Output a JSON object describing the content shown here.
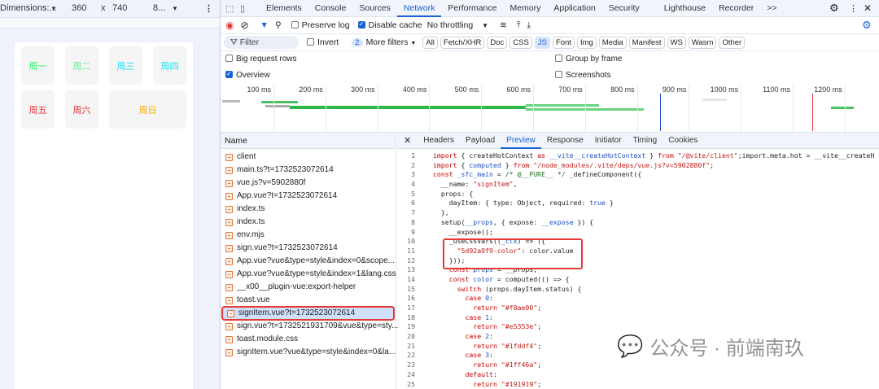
{
  "device": {
    "dimensions": "Dimensions:...",
    "width": "360",
    "x": "x",
    "height": "740",
    "zoom": "8..."
  },
  "page": {
    "days": [
      {
        "label": "周一",
        "color": "#1ff46a"
      },
      {
        "label": "周二",
        "color": "#6fe89a"
      },
      {
        "label": "周三",
        "color": "#1fddf4"
      },
      {
        "label": "周四",
        "color": "#1fddf4"
      },
      {
        "label": "周五",
        "color": "#e5353e"
      },
      {
        "label": "周六",
        "color": "#e5353e"
      },
      {
        "label": "周日",
        "color": "#f8ae00"
      }
    ]
  },
  "devtools": {
    "tabs": [
      "Elements",
      "Console",
      "Sources",
      "Network",
      "Performance",
      "Memory",
      "Application",
      "Security",
      "Lighthouse",
      "Recorder",
      ">>"
    ],
    "active_tab": "Network",
    "toolbar": {
      "preserve_log": "Preserve log",
      "disable_cache": "Disable cache",
      "throttling": "No throttling"
    },
    "filter": {
      "placeholder": "Filter",
      "invert": "Invert",
      "more_filters_count": "2",
      "more_filters": "More filters",
      "types": [
        "All",
        "Fetch/XHR",
        "Doc",
        "CSS",
        "JS",
        "Font",
        "Img",
        "Media",
        "Manifest",
        "WS",
        "Wasm",
        "Other"
      ],
      "active_type": "JS"
    },
    "options": {
      "big_rows": "Big request rows",
      "group_frame": "Group by frame",
      "overview": "Overview",
      "screenshots": "Screenshots"
    },
    "timeline": [
      "100 ms",
      "200 ms",
      "300 ms",
      "400 ms",
      "500 ms",
      "600 ms",
      "700 ms",
      "800 ms",
      "900 ms",
      "1000 ms",
      "1100 ms",
      "1200 ms"
    ],
    "name_header": "Name",
    "requests": [
      "client",
      "main.ts?t=1732523072614",
      "vue.js?v=5902880f",
      "App.vue?t=1732523072614",
      "index.ts",
      "index.ts",
      "env.mjs",
      "sign.vue?t=1732523072614",
      "App.vue?vue&type=style&index=0&scope...",
      "App.vue?vue&type=style&index=1&lang.css",
      "__x00__plugin-vue:export-helper",
      "toast.vue",
      "signItem.vue?t=1732523072614",
      "sign.vue?t=1732521931709&vue&type=sty...",
      "toast.module.css",
      "signItem.vue?vue&type=style&index=0&la..."
    ],
    "selected_request": "signItem.vue?t=1732523072614",
    "preview_tabs": [
      "Headers",
      "Payload",
      "Preview",
      "Response",
      "Initiator",
      "Timing",
      "Cookies"
    ],
    "active_preview_tab": "Preview",
    "code": [
      [
        [
          "import ",
          "k"
        ],
        [
          "{ createHotContext ",
          "p"
        ],
        [
          "as ",
          "k"
        ],
        [
          "__vite__createHotContext ",
          "b"
        ],
        [
          "} ",
          "p"
        ],
        [
          "from ",
          "k"
        ],
        [
          "\"/@vite/client\"",
          "s"
        ],
        [
          ";import.meta.hot = __vite__createH",
          "p"
        ]
      ],
      [
        [
          "import ",
          "k"
        ],
        [
          "{ ",
          "p"
        ],
        [
          "computed ",
          "b"
        ],
        [
          "} ",
          "p"
        ],
        [
          "from ",
          "k"
        ],
        [
          "\"/node_modules/.vite/deps/vue.js?v=5902880f\"",
          "s"
        ],
        [
          ";",
          "p"
        ]
      ],
      [
        [
          "const ",
          "k"
        ],
        [
          "_sfc_main ",
          "b"
        ],
        [
          "= ",
          "p"
        ],
        [
          "/* @__PURE__ */ ",
          "c"
        ],
        [
          "_defineComponent({",
          "p"
        ]
      ],
      [
        [
          "  __name: ",
          "p"
        ],
        [
          "\"signItem\"",
          "s"
        ],
        [
          ",",
          "p"
        ]
      ],
      [
        [
          "  props: {",
          "p"
        ]
      ],
      [
        [
          "    dayItem: { type: Object, required: ",
          "p"
        ],
        [
          "true ",
          "b"
        ],
        [
          "}",
          "p"
        ]
      ],
      [
        [
          "  },",
          "p"
        ]
      ],
      [
        [
          "  setup(",
          "p"
        ],
        [
          "__props",
          "b"
        ],
        [
          ", { expose: ",
          "p"
        ],
        [
          "__expose",
          "b"
        ],
        [
          " }) {",
          "p"
        ]
      ],
      [
        [
          "    __expose();",
          "p"
        ]
      ],
      [
        [
          "    _useCssVars((",
          "p"
        ],
        [
          "_ctx",
          "b"
        ],
        [
          ") => ({",
          "p"
        ]
      ],
      [
        [
          "      ",
          "p"
        ],
        [
          "\"5d92a9f9-color\"",
          "s"
        ],
        [
          ": color.value",
          "p"
        ]
      ],
      [
        [
          "    }));",
          "p"
        ]
      ],
      [
        [
          "    ",
          "p"
        ],
        [
          "const ",
          "k"
        ],
        [
          "props ",
          "b"
        ],
        [
          "= __props;",
          "p"
        ]
      ],
      [
        [
          "    ",
          "p"
        ],
        [
          "const ",
          "k"
        ],
        [
          "color ",
          "b"
        ],
        [
          "= computed(() => {",
          "p"
        ]
      ],
      [
        [
          "      ",
          "p"
        ],
        [
          "switch ",
          "k"
        ],
        [
          "(props.dayItem.status) {",
          "p"
        ]
      ],
      [
        [
          "        ",
          "p"
        ],
        [
          "case ",
          "k"
        ],
        [
          "0",
          "b"
        ],
        [
          ":",
          "p"
        ]
      ],
      [
        [
          "          ",
          "p"
        ],
        [
          "return ",
          "k"
        ],
        [
          "\"#f8ae00\"",
          "s"
        ],
        [
          ";",
          "p"
        ]
      ],
      [
        [
          "        ",
          "p"
        ],
        [
          "case ",
          "k"
        ],
        [
          "1",
          "b"
        ],
        [
          ":",
          "p"
        ]
      ],
      [
        [
          "          ",
          "p"
        ],
        [
          "return ",
          "k"
        ],
        [
          "\"#e5353e\"",
          "s"
        ],
        [
          ";",
          "p"
        ]
      ],
      [
        [
          "        ",
          "p"
        ],
        [
          "case ",
          "k"
        ],
        [
          "2",
          "b"
        ],
        [
          ":",
          "p"
        ]
      ],
      [
        [
          "          ",
          "p"
        ],
        [
          "return ",
          "k"
        ],
        [
          "\"#1fddf4\"",
          "s"
        ],
        [
          ";",
          "p"
        ]
      ],
      [
        [
          "        ",
          "p"
        ],
        [
          "case ",
          "k"
        ],
        [
          "3",
          "b"
        ],
        [
          ":",
          "p"
        ]
      ],
      [
        [
          "          ",
          "p"
        ],
        [
          "return ",
          "k"
        ],
        [
          "\"#1ff46a\"",
          "s"
        ],
        [
          ";",
          "p"
        ]
      ],
      [
        [
          "        ",
          "p"
        ],
        [
          "default",
          "k"
        ],
        [
          ":",
          "p"
        ]
      ],
      [
        [
          "          ",
          "p"
        ],
        [
          "return ",
          "k"
        ],
        [
          "\"#191919\"",
          "s"
        ],
        [
          ";",
          "p"
        ]
      ]
    ]
  },
  "watermark": "公众号 · 前端南玖"
}
